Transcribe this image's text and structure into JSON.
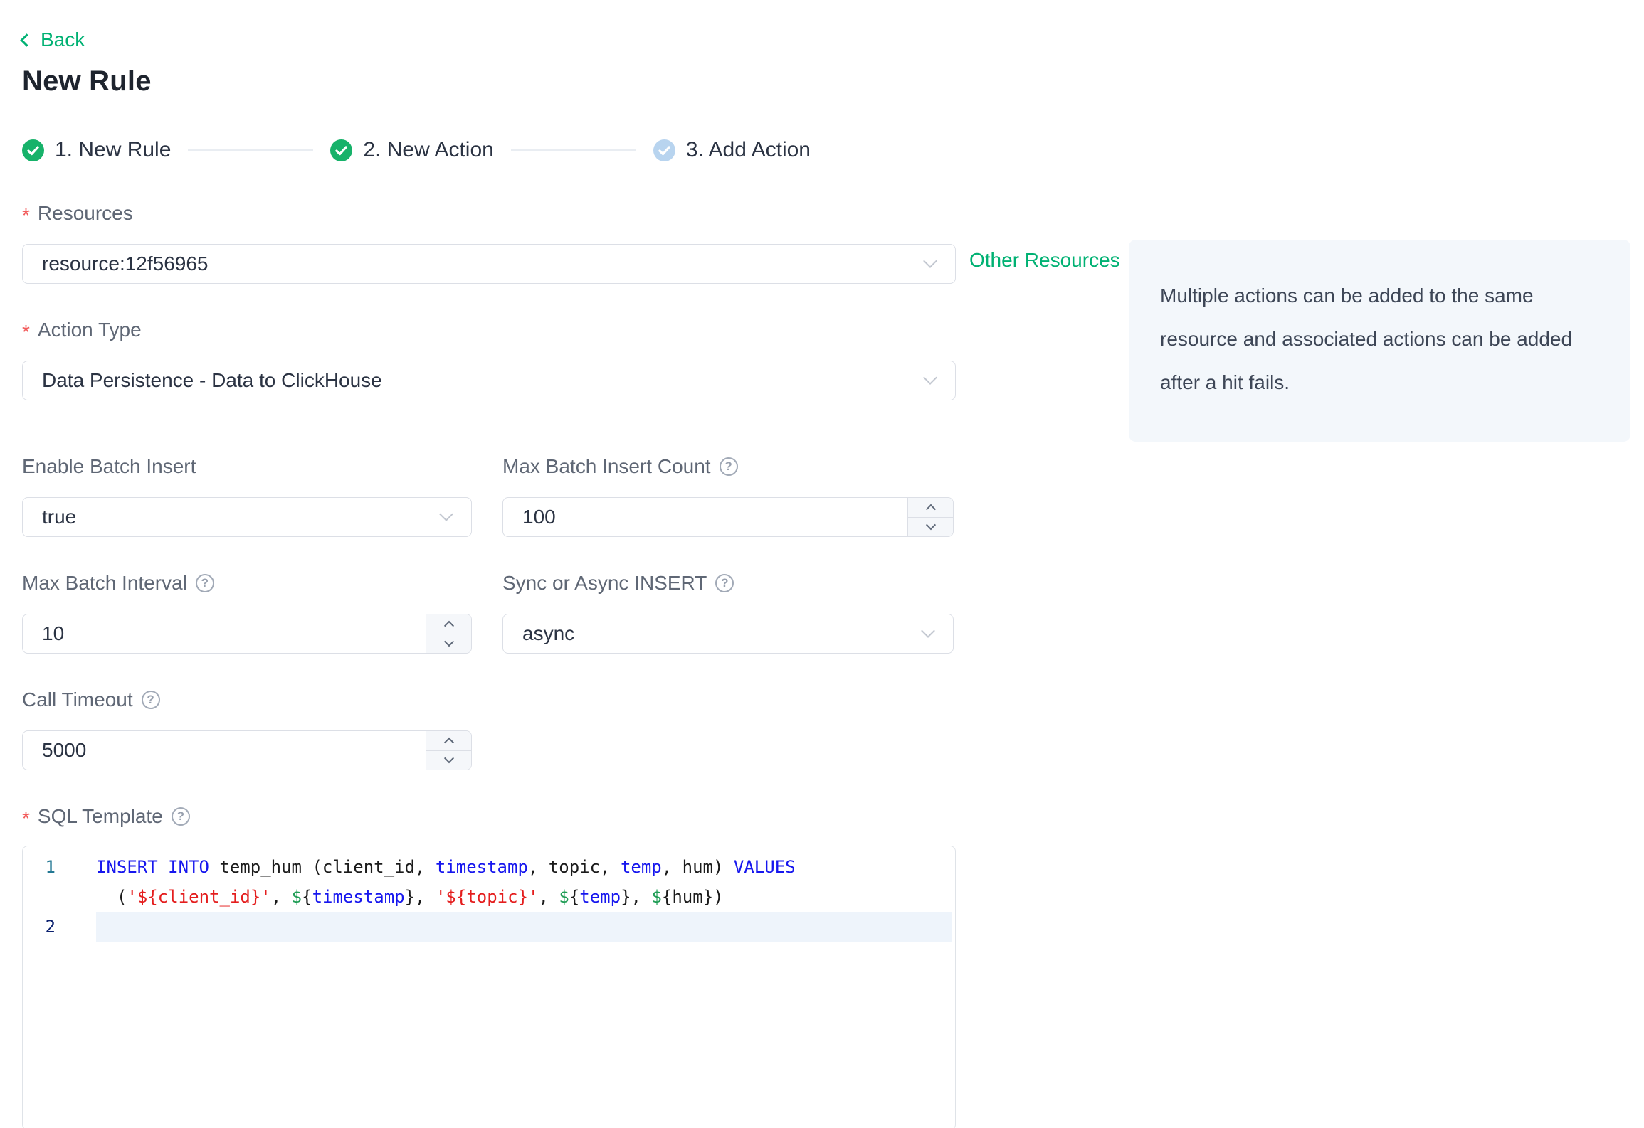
{
  "header": {
    "back": "Back",
    "title": "New Rule"
  },
  "steps": {
    "items": [
      {
        "label": "1. New Rule",
        "state": "done"
      },
      {
        "label": "2. New Action",
        "state": "done"
      },
      {
        "label": "3. Add Action",
        "state": "pending"
      }
    ]
  },
  "form": {
    "required_marker": "*",
    "resources": {
      "label": "Resources",
      "value": "resource:12f56965"
    },
    "other_resources": "Other Resources",
    "info_note": "Multiple actions can be added to the same resource and associated actions can be added after a hit fails.",
    "action_type": {
      "label": "Action Type",
      "value": "Data Persistence - Data to ClickHouse"
    },
    "enable_batch_insert": {
      "label": "Enable Batch Insert",
      "value": "true"
    },
    "max_batch_insert_count": {
      "label": "Max Batch Insert Count",
      "value": "100"
    },
    "max_batch_interval": {
      "label": "Max Batch Interval",
      "value": "10"
    },
    "sync_or_async": {
      "label": "Sync or Async INSERT",
      "value": "async"
    },
    "call_timeout": {
      "label": "Call Timeout",
      "value": "5000"
    },
    "sql_template": {
      "label": "SQL Template"
    },
    "help_glyph": "?"
  },
  "sql": {
    "gutter": [
      "1",
      "2"
    ],
    "line1": [
      {
        "t": "INSERT INTO"
      },
      {
        "t": " temp_hum (client_id, "
      },
      {
        "t": "timestamp"
      },
      {
        "t": ", topic, "
      },
      {
        "t": "temp"
      },
      {
        "t": ", hum) "
      },
      {
        "t": "VALUES"
      }
    ],
    "line1_wrap": [
      {
        "t": "("
      },
      {
        "t": "'${client_id}'"
      },
      {
        "t": ", "
      },
      {
        "t": "$"
      },
      {
        "t": "{"
      },
      {
        "t": "timestamp"
      },
      {
        "t": "}, "
      },
      {
        "t": "'${topic}'"
      },
      {
        "t": ", "
      },
      {
        "t": "$"
      },
      {
        "t": "{"
      },
      {
        "t": "temp"
      },
      {
        "t": "}, "
      },
      {
        "t": "$"
      },
      {
        "t": "{hum})"
      }
    ]
  },
  "colors": {
    "accent_green": "#00b173",
    "step_done": "#17b26a",
    "step_pending": "#b8d4ef",
    "required_red": "#f25c5c",
    "code_keyword": "#1616ee",
    "code_string": "#e41e1e",
    "code_dollar": "#1f9d55",
    "active_line_bg": "#eef4fb",
    "line_number": "#237893",
    "line_number_active": "#0b216f",
    "info_card_bg": "#f3f7fb"
  }
}
